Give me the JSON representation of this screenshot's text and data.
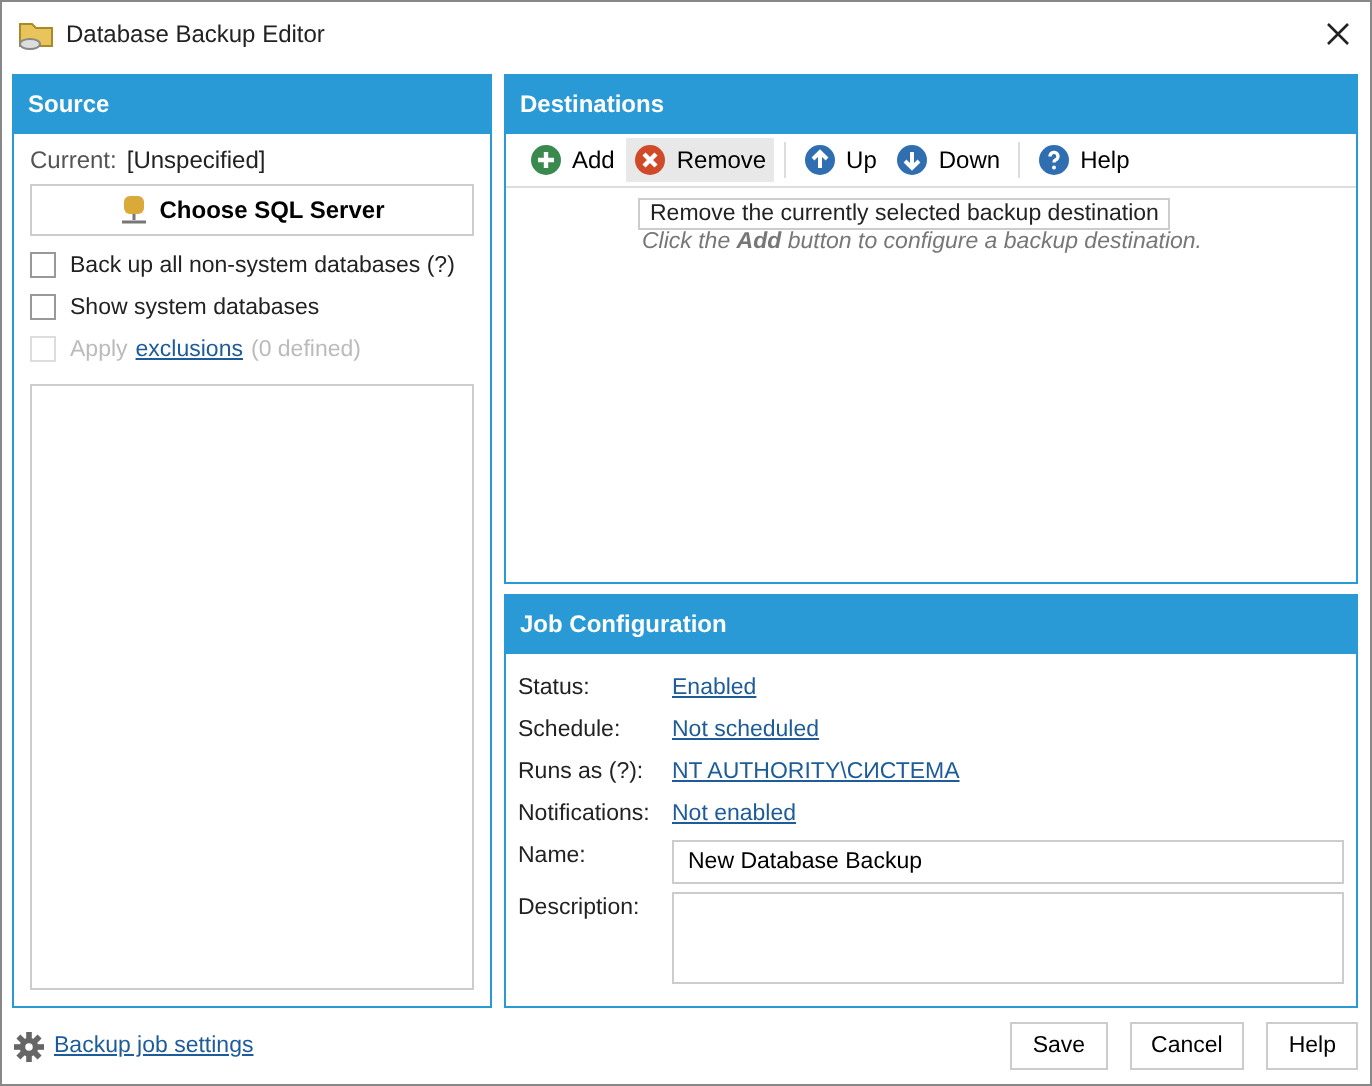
{
  "window": {
    "title": "Database Backup Editor"
  },
  "source": {
    "title": "Source",
    "current_label": "Current:",
    "current_value": "[Unspecified]",
    "choose_button": "Choose SQL Server",
    "options": [
      {
        "label": "Back up all non-system databases (?)",
        "checked": false,
        "disabled": false
      },
      {
        "label": "Show system databases",
        "checked": false,
        "disabled": false
      },
      {
        "label": "Apply",
        "link": "exclusions",
        "suffix": "(0 defined)",
        "checked": false,
        "disabled": true
      }
    ]
  },
  "destinations": {
    "title": "Destinations",
    "toolbar": [
      {
        "label": "Add",
        "kind": "add",
        "hovered": false
      },
      {
        "label": "Remove",
        "kind": "remove",
        "hovered": true
      },
      {
        "label": "Up",
        "kind": "up",
        "hovered": false
      },
      {
        "label": "Down",
        "kind": "down",
        "hovered": false
      },
      {
        "label": "Help",
        "kind": "help",
        "hovered": false
      }
    ],
    "tooltip": "Remove the currently selected backup destination",
    "hint": "Click the **Add** button to configure a backup destination."
  },
  "job_configuration": {
    "title": "Job Configuration",
    "links": [
      {
        "label": "Status:",
        "value": "Enabled"
      },
      {
        "label": "Schedule:",
        "value": "Not scheduled"
      },
      {
        "label": "Runs as (?):",
        "value": "NT AUTHORITY\\СИСТЕМА"
      },
      {
        "label": "Notifications:",
        "value": "Not enabled"
      }
    ],
    "name_label": "Name:",
    "name_value": "New Database Backup",
    "description_label": "Description:"
  },
  "footer": {
    "settings_link": "Backup job settings",
    "buttons": [
      "Save",
      "Cancel",
      "Help"
    ]
  }
}
